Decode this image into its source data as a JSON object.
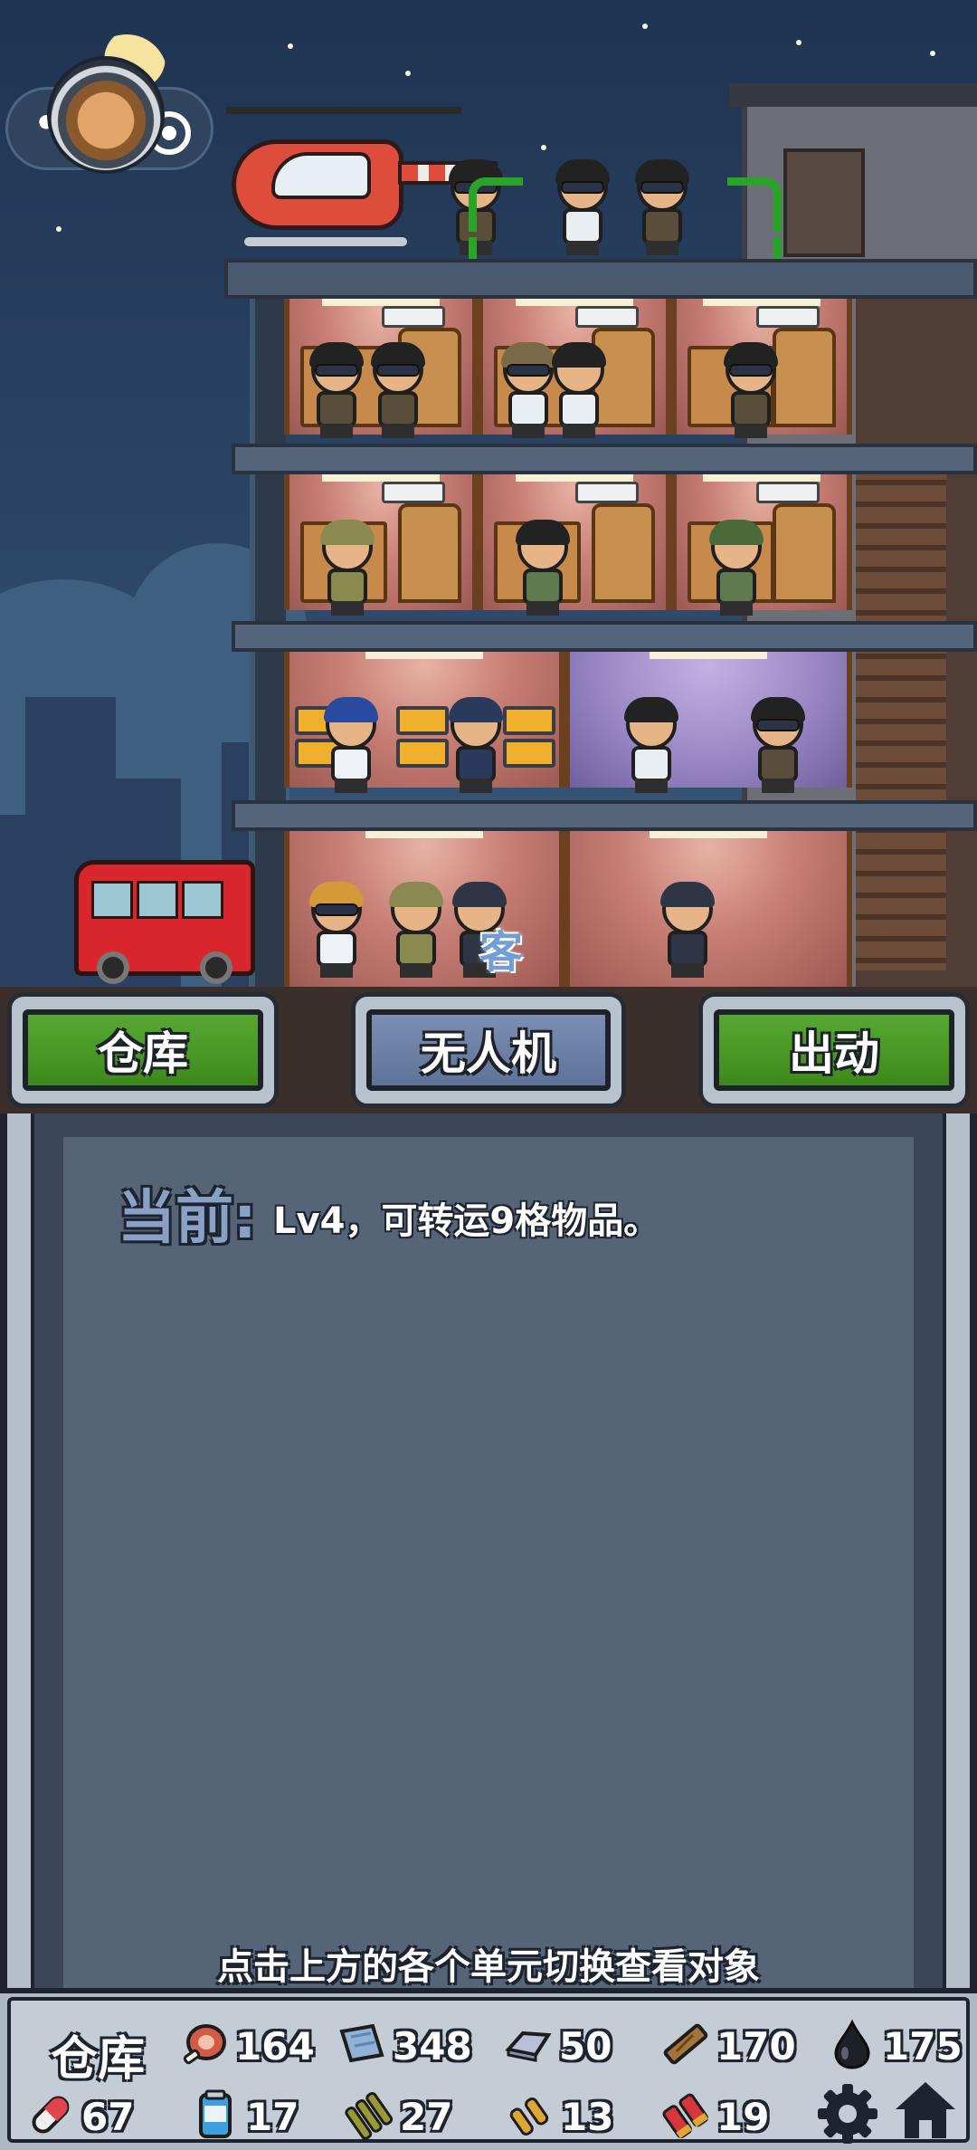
{
  "scene": {
    "guest_tag": "客"
  },
  "tabs": [
    {
      "label": "仓库",
      "style": "green",
      "selected": false
    },
    {
      "label": "无人机",
      "style": "blue",
      "selected": true
    },
    {
      "label": "出动",
      "style": "green",
      "selected": false
    }
  ],
  "info": {
    "current_label": "当前:",
    "current_text": "Lv4，可转运9格物品。",
    "hint": "点击上方的各个单元切换查看对象"
  },
  "resources": {
    "title": "仓库",
    "row1": [
      {
        "icon": "meat-icon",
        "value": "164"
      },
      {
        "icon": "cloth-icon",
        "value": "348"
      },
      {
        "icon": "metal-ingot-icon",
        "value": "50"
      },
      {
        "icon": "wood-plank-icon",
        "value": "170"
      },
      {
        "icon": "oil-drop-icon",
        "value": "175"
      }
    ],
    "row2": [
      {
        "icon": "medicine-pill-icon",
        "value": "67"
      },
      {
        "icon": "water-can-icon",
        "value": "17"
      },
      {
        "icon": "rifle-ammo-icon",
        "value": "27"
      },
      {
        "icon": "pistol-ammo-icon",
        "value": "13"
      },
      {
        "icon": "shotgun-shell-icon",
        "value": "19"
      }
    ]
  },
  "colors": {
    "tab_green": "#4a9a28",
    "tab_blue": "#6d81a8",
    "panel": "#556477",
    "selection_bracket": "#2aa428"
  }
}
